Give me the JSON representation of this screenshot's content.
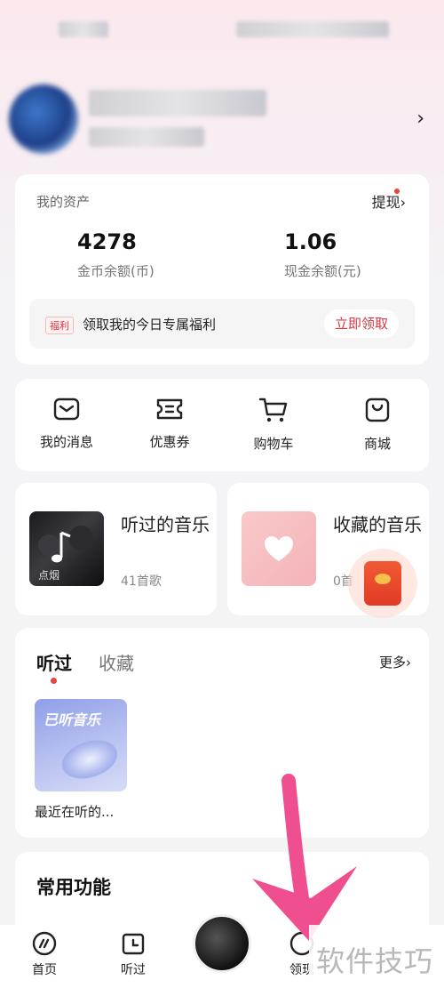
{
  "assets": {
    "title": "我的资产",
    "withdraw_label": "提现",
    "coin_value": "4278",
    "coin_label": "金币余额(币)",
    "cash_value": "1.06",
    "cash_label": "现金余额(元)",
    "welfare_tag": "福利",
    "welfare_text": "领取我的今日专属福利",
    "welfare_button": "立即领取"
  },
  "quick_actions": [
    {
      "label": "我的消息",
      "icon": "message-icon"
    },
    {
      "label": "优惠券",
      "icon": "coupon-icon"
    },
    {
      "label": "购物车",
      "icon": "cart-icon"
    },
    {
      "label": "商城",
      "icon": "shop-bag-icon"
    }
  ],
  "music": {
    "listened_title": "听过的音乐",
    "listened_count": "41首歌",
    "favorite_title": "收藏的音乐",
    "favorite_count": "0首"
  },
  "history": {
    "tab_listened": "听过",
    "tab_favorite": "收藏",
    "more_label": "更多",
    "recent_cover_text": "已听音乐",
    "recent_label": "最近在听的..."
  },
  "functions": {
    "title": "常用功能"
  },
  "tabbar": {
    "home": "首页",
    "listened": "听过",
    "earn": "领现"
  },
  "watermark": "软件技巧",
  "colors": {
    "accent_red": "#d9363e",
    "arrow_pink": "#ef4f8e"
  }
}
